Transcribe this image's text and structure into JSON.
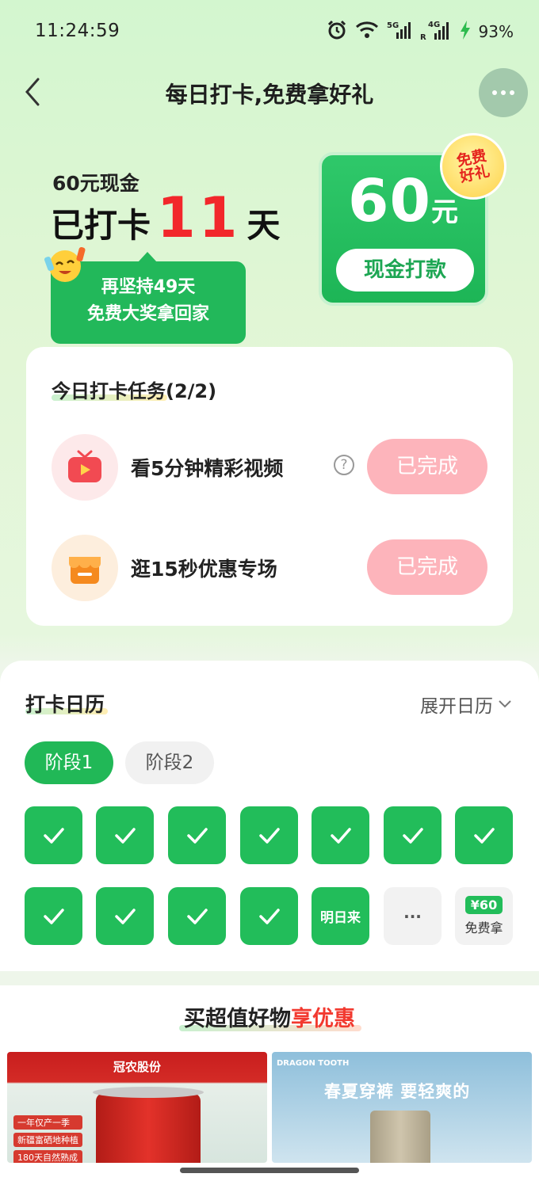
{
  "status_bar": {
    "time": "11:24:59",
    "battery": "93%",
    "net1": "5G",
    "net2": "4G"
  },
  "nav": {
    "title": "每日打卡,免费拿好礼"
  },
  "hero": {
    "cash_label": "60元现金",
    "checked_prefix": "已打卡",
    "checked_days": "11",
    "checked_suffix": "天",
    "tip_line1": "再坚持49天",
    "tip_line2": "免费大奖拿回家",
    "prize_number": "60",
    "prize_unit": "元",
    "prize_button": "现金打款",
    "badge_line1": "免费",
    "badge_line2": "好礼"
  },
  "tasks": {
    "title": "今日打卡任务(2/2)",
    "items": [
      {
        "label": "看5分钟精彩视频",
        "status": "已完成",
        "icon": "tv-icon"
      },
      {
        "label": "逛15秒优惠专场",
        "status": "已完成",
        "icon": "shop-icon"
      }
    ]
  },
  "calendar": {
    "title": "打卡日历",
    "expand": "展开日历",
    "stages": [
      "阶段1",
      "阶段2"
    ],
    "next_label": "明日来",
    "more_label": "···",
    "reward_amount": "¥60",
    "reward_label": "免费拿",
    "checked_count": 11
  },
  "deals": {
    "title_normal": "买超值好物",
    "title_accent": "享优惠",
    "product_left": {
      "brand": "冠农股份",
      "tags": [
        "一年仅产一季",
        "新疆富硒地种植",
        "180天自然熟成"
      ]
    },
    "product_right": {
      "brand": "DRAGON TOOTH",
      "slogan": "春夏穿裤 要轻爽的"
    }
  },
  "colors": {
    "green": "#22bd5a",
    "red": "#f2272b",
    "pink": "#fdb4bb"
  }
}
